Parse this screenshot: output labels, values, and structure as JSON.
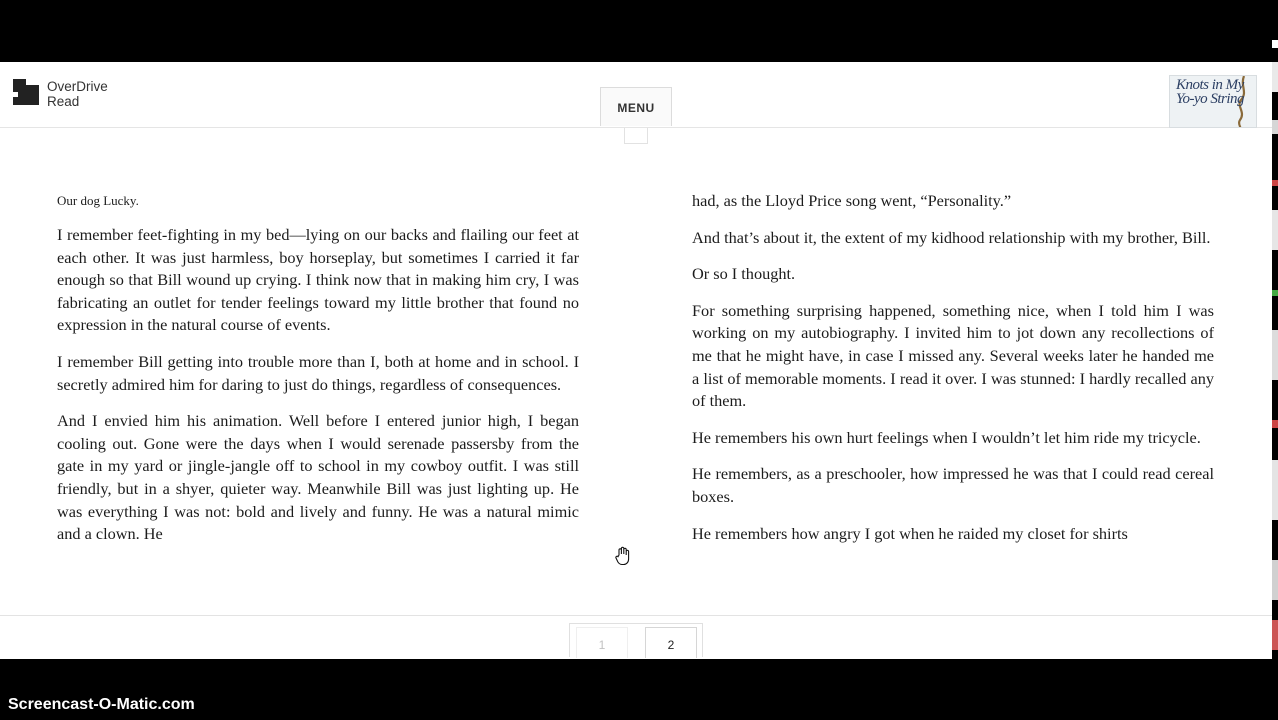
{
  "app": {
    "logo_line1": "OverDrive",
    "logo_line2": "Read",
    "menu_label": "MENU",
    "cover_title": "Knots in My Yo-yo String"
  },
  "reader": {
    "left_page": {
      "caption": "Our dog Lucky.",
      "paragraphs": [
        "I remember feet-fighting in my bed—lying on our backs and flailing our feet at each other. It was just harmless, boy horseplay, but sometimes I carried it far enough so that Bill wound up crying. I think now that in making him cry, I was fabricating an outlet for tender feelings toward my little brother that found no expression in the natural course of events.",
        "I remember Bill getting into trouble more than I, both at home and in school. I secretly admired him for daring to just do things, regardless of consequences.",
        "And I envied him his animation. Well before I entered junior high, I began cooling out. Gone were the days when I would serenade passersby from the gate in my yard or jingle-jangle off to school in my cowboy outfit. I was still friendly, but in a shyer, quieter way. Meanwhile Bill was just lighting up. He was everything I was not: bold and lively and funny. He was a natural mimic and a clown. He"
      ]
    },
    "right_page": {
      "paragraphs": [
        "had, as the Lloyd Price song went, “Personality.”",
        "And that’s about it, the extent of my kidhood relationship with my brother, Bill.",
        "Or so I thought.",
        "For something surprising happened, something nice, when I told him I was working on my autobiography. I invited him to jot down any recollections of me that he might have, in case I missed any. Several weeks later he handed me a list of memorable moments. I read it over. I was stunned: I hardly recalled any of them.",
        "He remembers his own hurt feelings when I wouldn’t let him ride my tricycle.",
        "He remembers, as a preschooler, how impressed he was that I could read cereal boxes.",
        "He remembers how angry I got when he raided my closet for shirts"
      ]
    }
  },
  "pager": {
    "page1": "1",
    "page2": "2",
    "current": "2"
  },
  "watermark": "Screencast-O-Matic.com",
  "colors": {
    "frame": "#000000",
    "page_bg": "#ffffff",
    "text": "#1c1c1c",
    "cover_title": "#2c3f63"
  }
}
